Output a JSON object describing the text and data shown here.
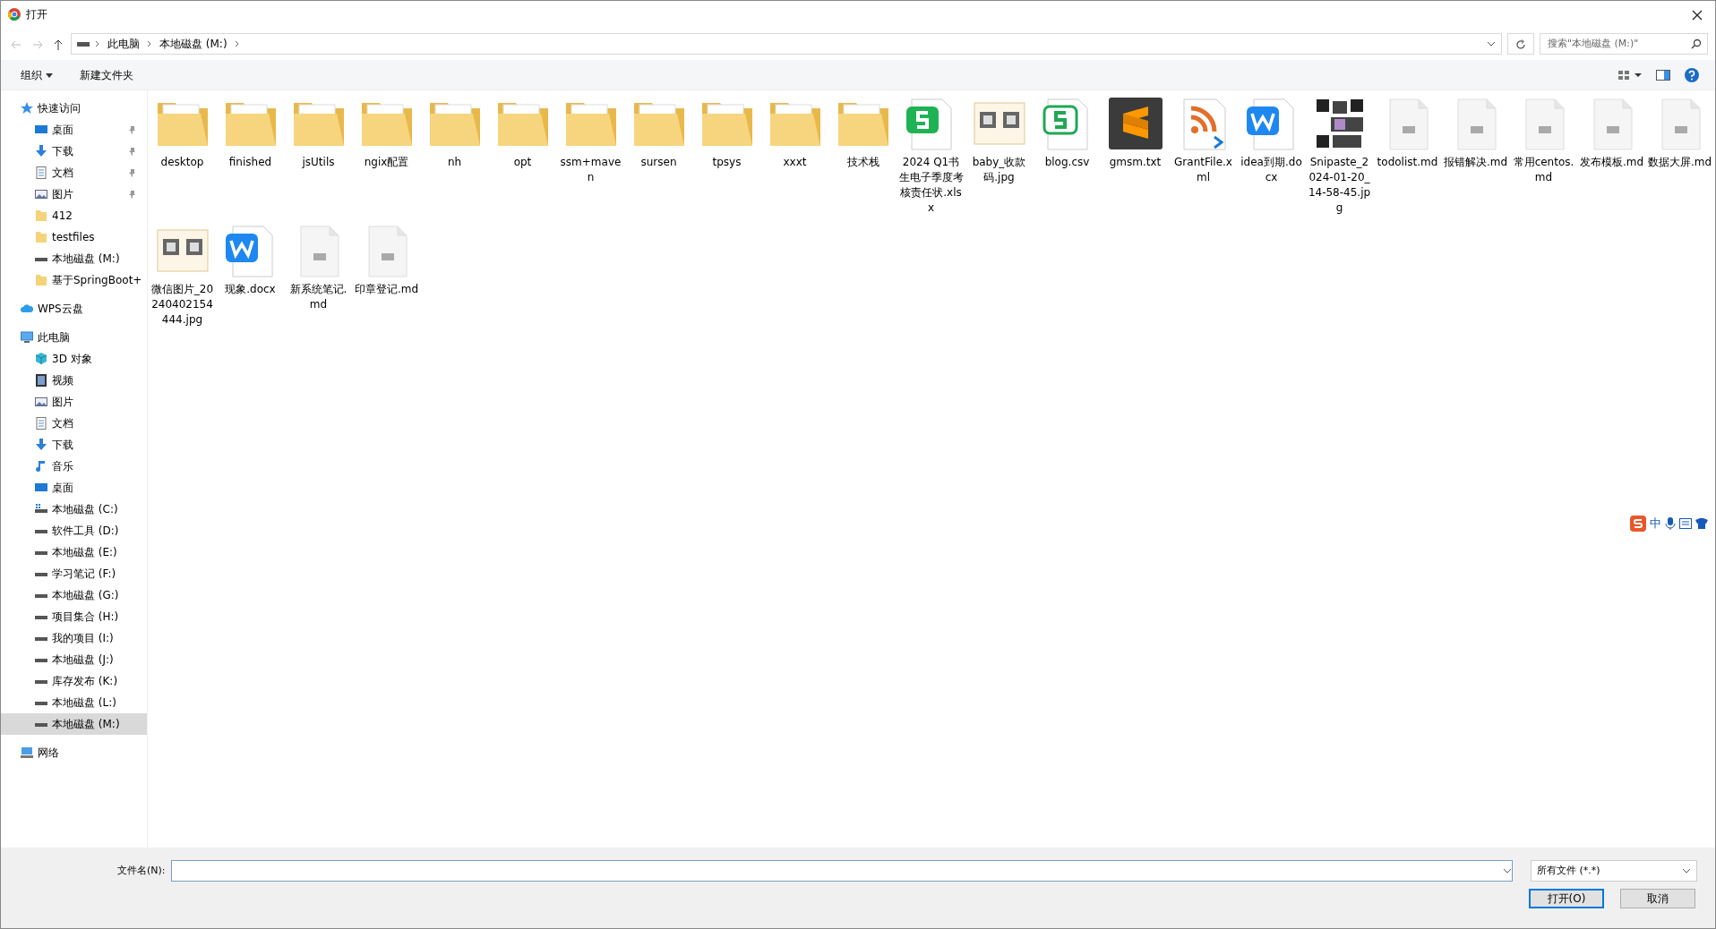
{
  "window": {
    "title": "打开"
  },
  "address": {
    "crumbs": [
      "此电脑",
      "本地磁盘 (M:)"
    ]
  },
  "search": {
    "placeholder": "搜索\"本地磁盘 (M:)\""
  },
  "toolbar": {
    "buttons": [
      "组织",
      "新建文件夹"
    ]
  },
  "sidebar": {
    "items": [
      {
        "label": "快速访问",
        "kind": "star",
        "selected": false,
        "children": [
          {
            "label": "桌面",
            "kind": "desktop",
            "pinned": true,
            "selected": false
          },
          {
            "label": "下载",
            "kind": "download",
            "pinned": true,
            "selected": false
          },
          {
            "label": "文档",
            "kind": "doc",
            "pinned": true,
            "selected": false
          },
          {
            "label": "图片",
            "kind": "pic",
            "pinned": true,
            "selected": false
          },
          {
            "label": "412",
            "kind": "folder",
            "pinned": false,
            "selected": false
          },
          {
            "label": "testfiles",
            "kind": "folder",
            "pinned": false,
            "selected": false
          },
          {
            "label": "本地磁盘 (M:)",
            "kind": "drive",
            "pinned": false,
            "selected": false
          },
          {
            "label": "基于SpringBoot+",
            "kind": "folder",
            "pinned": false,
            "selected": false
          }
        ]
      },
      {
        "label": "WPS云盘",
        "kind": "cloud",
        "selected": false
      },
      {
        "label": "此电脑",
        "kind": "pc",
        "selected": false,
        "children": [
          {
            "label": "3D 对象",
            "kind": "cube",
            "selected": false
          },
          {
            "label": "视频",
            "kind": "video",
            "selected": false
          },
          {
            "label": "图片",
            "kind": "pic",
            "selected": false
          },
          {
            "label": "文档",
            "kind": "doc",
            "selected": false
          },
          {
            "label": "下载",
            "kind": "download",
            "selected": false
          },
          {
            "label": "音乐",
            "kind": "music",
            "selected": false
          },
          {
            "label": "桌面",
            "kind": "desktop",
            "selected": false
          },
          {
            "label": "本地磁盘 (C:)",
            "kind": "sysdrive",
            "selected": false
          },
          {
            "label": "软件工具 (D:)",
            "kind": "drive",
            "selected": false
          },
          {
            "label": "本地磁盘 (E:)",
            "kind": "drive",
            "selected": false
          },
          {
            "label": "学习笔记 (F:)",
            "kind": "drive",
            "selected": false
          },
          {
            "label": "本地磁盘 (G:)",
            "kind": "drive",
            "selected": false
          },
          {
            "label": "项目集合 (H:)",
            "kind": "drive",
            "selected": false
          },
          {
            "label": "我的项目 (I:)",
            "kind": "drive",
            "selected": false
          },
          {
            "label": "本地磁盘 (J:)",
            "kind": "drive",
            "selected": false
          },
          {
            "label": "库存发布 (K:)",
            "kind": "drive",
            "selected": false
          },
          {
            "label": "本地磁盘 (L:)",
            "kind": "drive",
            "selected": false
          },
          {
            "label": "本地磁盘 (M:)",
            "kind": "drive",
            "selected": true
          }
        ]
      },
      {
        "label": "网络",
        "kind": "network",
        "selected": false
      }
    ]
  },
  "files": [
    {
      "name": "desktop",
      "kind": "folder"
    },
    {
      "name": "finished",
      "kind": "folder"
    },
    {
      "name": "jsUtils",
      "kind": "folder"
    },
    {
      "name": "ngix配置",
      "kind": "folder"
    },
    {
      "name": "nh",
      "kind": "folder"
    },
    {
      "name": "opt",
      "kind": "folder"
    },
    {
      "name": "ssm+maven",
      "kind": "folder"
    },
    {
      "name": "sursen",
      "kind": "folder"
    },
    {
      "name": "tpsys",
      "kind": "folder"
    },
    {
      "name": "xxxt",
      "kind": "folder"
    },
    {
      "name": "技术栈",
      "kind": "folder"
    },
    {
      "name": "2024 Q1书生电子季度考核责任状.xlsx",
      "kind": "sheet"
    },
    {
      "name": "baby_收款码.jpg",
      "kind": "image"
    },
    {
      "name": "blog.csv",
      "kind": "csv"
    },
    {
      "name": "gmsm.txt",
      "kind": "sublime"
    },
    {
      "name": "GrantFile.xml",
      "kind": "feed"
    },
    {
      "name": "idea到期.docx",
      "kind": "word"
    },
    {
      "name": "Snipaste_2024-01-20_14-58-45.jpg",
      "kind": "qr"
    },
    {
      "name": "todolist.md",
      "kind": "md"
    },
    {
      "name": "报错解决.md",
      "kind": "md"
    },
    {
      "name": "常用centos.md",
      "kind": "md"
    },
    {
      "name": "发布模板.md",
      "kind": "md"
    },
    {
      "name": "数据大屏.md",
      "kind": "md"
    },
    {
      "name": "微信图片_20240402154444.jpg",
      "kind": "image"
    },
    {
      "name": "现象.docx",
      "kind": "word"
    },
    {
      "name": "新系统笔记.md",
      "kind": "md"
    },
    {
      "name": "印章登记.md",
      "kind": "md"
    }
  ],
  "ime_toolbar": {
    "label": "中"
  },
  "footer": {
    "filename_label": "文件名(N):",
    "filter": "所有文件 (*.*)",
    "buttons": [
      "打开(O)",
      "取消"
    ]
  }
}
